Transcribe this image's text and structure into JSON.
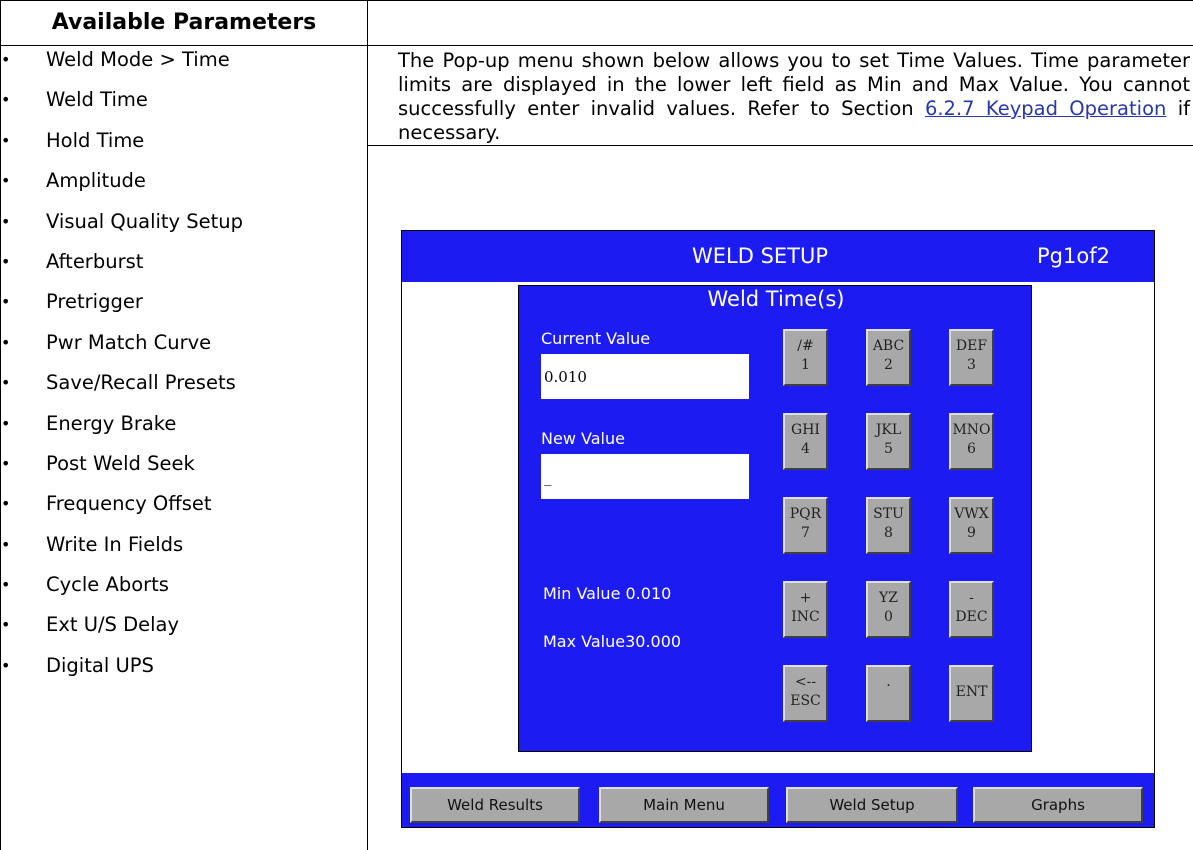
{
  "header": {
    "title": "Available Parameters"
  },
  "parameters": [
    "Weld Mode > Time",
    "Weld Time",
    "Hold Time",
    "Amplitude",
    "Visual Quality Setup",
    "Afterburst",
    "Pretrigger",
    "Pwr Match Curve",
    "Save/Recall Presets",
    "Energy Brake",
    "Post Weld Seek",
    "Frequency Offset",
    "Write In Fields",
    "Cycle Aborts",
    "Ext U/S Delay",
    "Digital UPS"
  ],
  "description": {
    "text_before": "The Pop-up menu shown below allows you to set Time Values. Time parameter limits are displayed in the lower left field as Min and Max Value. You cannot successfully enter invalid values. Refer to Section ",
    "link_text": "6.2.7 Keypad Operation",
    "text_after": " if necessary."
  },
  "screen": {
    "title": "WELD SETUP",
    "page": "Pg1of2",
    "popup": {
      "title": "Weld Time(s)",
      "current_label": "Current Value",
      "current_value": "0.010",
      "new_label": "New Value",
      "new_value": "_",
      "min_label": "Min Value 0.010",
      "max_label": "Max Value30.000"
    },
    "keys": [
      {
        "top": "/#",
        "bottom": "1"
      },
      {
        "top": "ABC",
        "bottom": "2"
      },
      {
        "top": "DEF",
        "bottom": "3"
      },
      {
        "top": "GHI",
        "bottom": "4"
      },
      {
        "top": "JKL",
        "bottom": "5"
      },
      {
        "top": "MNO",
        "bottom": "6"
      },
      {
        "top": "PQR",
        "bottom": "7"
      },
      {
        "top": "STU",
        "bottom": "8"
      },
      {
        "top": "VWX",
        "bottom": "9"
      },
      {
        "top": "+",
        "bottom": "INC"
      },
      {
        "top": "YZ",
        "bottom": "0"
      },
      {
        "top": "-",
        "bottom": "DEC"
      },
      {
        "top": "<--",
        "bottom": "ESC"
      },
      {
        "top": ".",
        "bottom": ""
      },
      {
        "top": "ENT",
        "bottom": ""
      }
    ],
    "bottom_buttons": [
      "Weld Results",
      "Main Menu",
      "Weld Setup",
      "Graphs"
    ]
  }
}
